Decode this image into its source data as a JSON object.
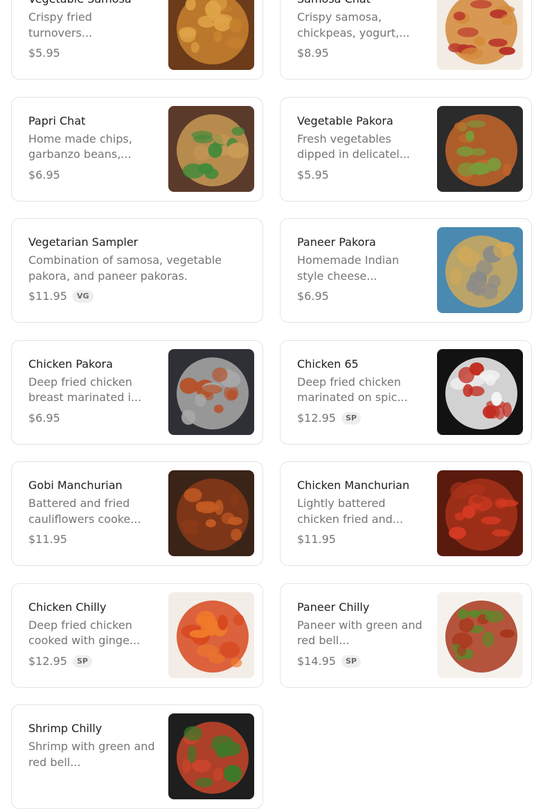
{
  "menu_items": [
    {
      "name": "Vegetable Samosa",
      "description": "Crispy fried turnovers...",
      "price": "$5.95",
      "badge": "",
      "image": "samosa-photo",
      "colors": [
        "#6b3b1a",
        "#c9822f",
        "#e0a548"
      ]
    },
    {
      "name": "Samosa Chat",
      "description": "Crispy samosa, chickpeas, yogurt,...",
      "price": "$8.95",
      "badge": "",
      "image": "samosa-chat-photo",
      "colors": [
        "#f2ece4",
        "#d48a3a",
        "#b8332a"
      ]
    },
    {
      "name": "Papri Chat",
      "description": "Home made chips, garbanzo beans,...",
      "price": "$6.95",
      "badge": "",
      "image": "papri-chat-photo",
      "colors": [
        "#5a3a2a",
        "#c89a55",
        "#3f8a3a"
      ]
    },
    {
      "name": "Vegetable Pakora",
      "description": "Fresh vegetables dipped in delicatel...",
      "price": "$5.95",
      "badge": "",
      "image": "pakora-photo",
      "colors": [
        "#2b2b2b",
        "#c3662a",
        "#7a9a3a"
      ]
    },
    {
      "name": "Vegetarian Sampler",
      "description": "Combination of samosa, vegetable pakora, and paneer pakoras.",
      "price": "$11.95",
      "badge": "VG",
      "image": "",
      "colors": []
    },
    {
      "name": "Paneer Pakora",
      "description": "Homemade Indian style cheese...",
      "price": "$6.95",
      "badge": "",
      "image": "paneer-pakora-photo",
      "colors": [
        "#4a8ab0",
        "#cfa85a",
        "#8a8a8a"
      ]
    },
    {
      "name": "Chicken Pakora",
      "description": "Deep fried chicken breast marinated i...",
      "price": "$6.95",
      "badge": "",
      "image": "chicken-pakora-photo",
      "colors": [
        "#2e3036",
        "#a9a9a9",
        "#b5522a"
      ]
    },
    {
      "name": "Chicken 65",
      "description": "Deep fried chicken marinated on spic...",
      "price": "$12.95",
      "badge": "SP",
      "image": "chicken-65-photo",
      "colors": [
        "#121212",
        "#f4f4f4",
        "#c22a1e"
      ]
    },
    {
      "name": "Gobi Manchurian",
      "description": "Battered and fried cauliflowers cooke...",
      "price": "$11.95",
      "badge": "",
      "image": "gobi-manchurian-photo",
      "colors": [
        "#3a2418",
        "#8a3a18",
        "#c25a22"
      ]
    },
    {
      "name": "Chicken Manchurian",
      "description": "Lightly battered chicken fried and...",
      "price": "$11.95",
      "badge": "",
      "image": "chicken-manchurian-photo",
      "colors": [
        "#5a1a0e",
        "#a8321a",
        "#d63a22"
      ]
    },
    {
      "name": "Chicken Chilly",
      "description": "Deep fried chicken cooked with ginge...",
      "price": "$12.95",
      "badge": "SP",
      "image": "chicken-chilly-photo",
      "colors": [
        "#f2ede6",
        "#d8481e",
        "#f07a2a"
      ]
    },
    {
      "name": "Paneer Chilly",
      "description": "Paneer with green and red bell...",
      "price": "$14.95",
      "badge": "SP",
      "image": "paneer-chilly-photo",
      "colors": [
        "#f5f2ee",
        "#a8381c",
        "#5a8a2a"
      ]
    },
    {
      "name": "Shrimp Chilly",
      "description": "Shrimp with green and red bell...",
      "price": "",
      "badge": "",
      "image": "shrimp-chilly-photo",
      "colors": [
        "#1e1e1e",
        "#c8452a",
        "#3a7a2a"
      ]
    }
  ]
}
